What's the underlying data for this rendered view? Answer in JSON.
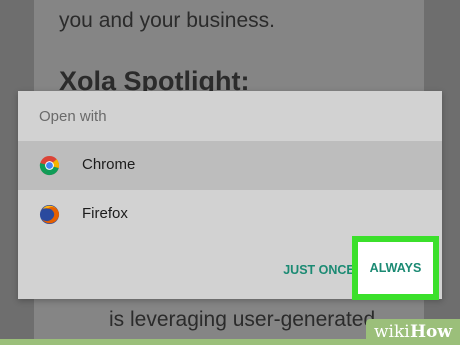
{
  "background_article": {
    "text_top": "you and your business.",
    "heading": "Xola Spotlight:",
    "text_bottom": "is leveraging user-generated"
  },
  "dialog": {
    "title": "Open with",
    "apps": [
      {
        "label": "Chrome",
        "icon": "chrome-icon"
      },
      {
        "label": "Firefox",
        "icon": "firefox-icon"
      }
    ],
    "just_once_label": "JUST ONCE",
    "always_label": "ALWAYS"
  },
  "colors": {
    "accent_button_text": "#1b8a73",
    "highlight_border": "#3be02b",
    "selected_row": "#bdbdbd",
    "dialog_bg": "#d2d2d2"
  },
  "watermark": {
    "wiki": "wiki",
    "how": "How"
  }
}
